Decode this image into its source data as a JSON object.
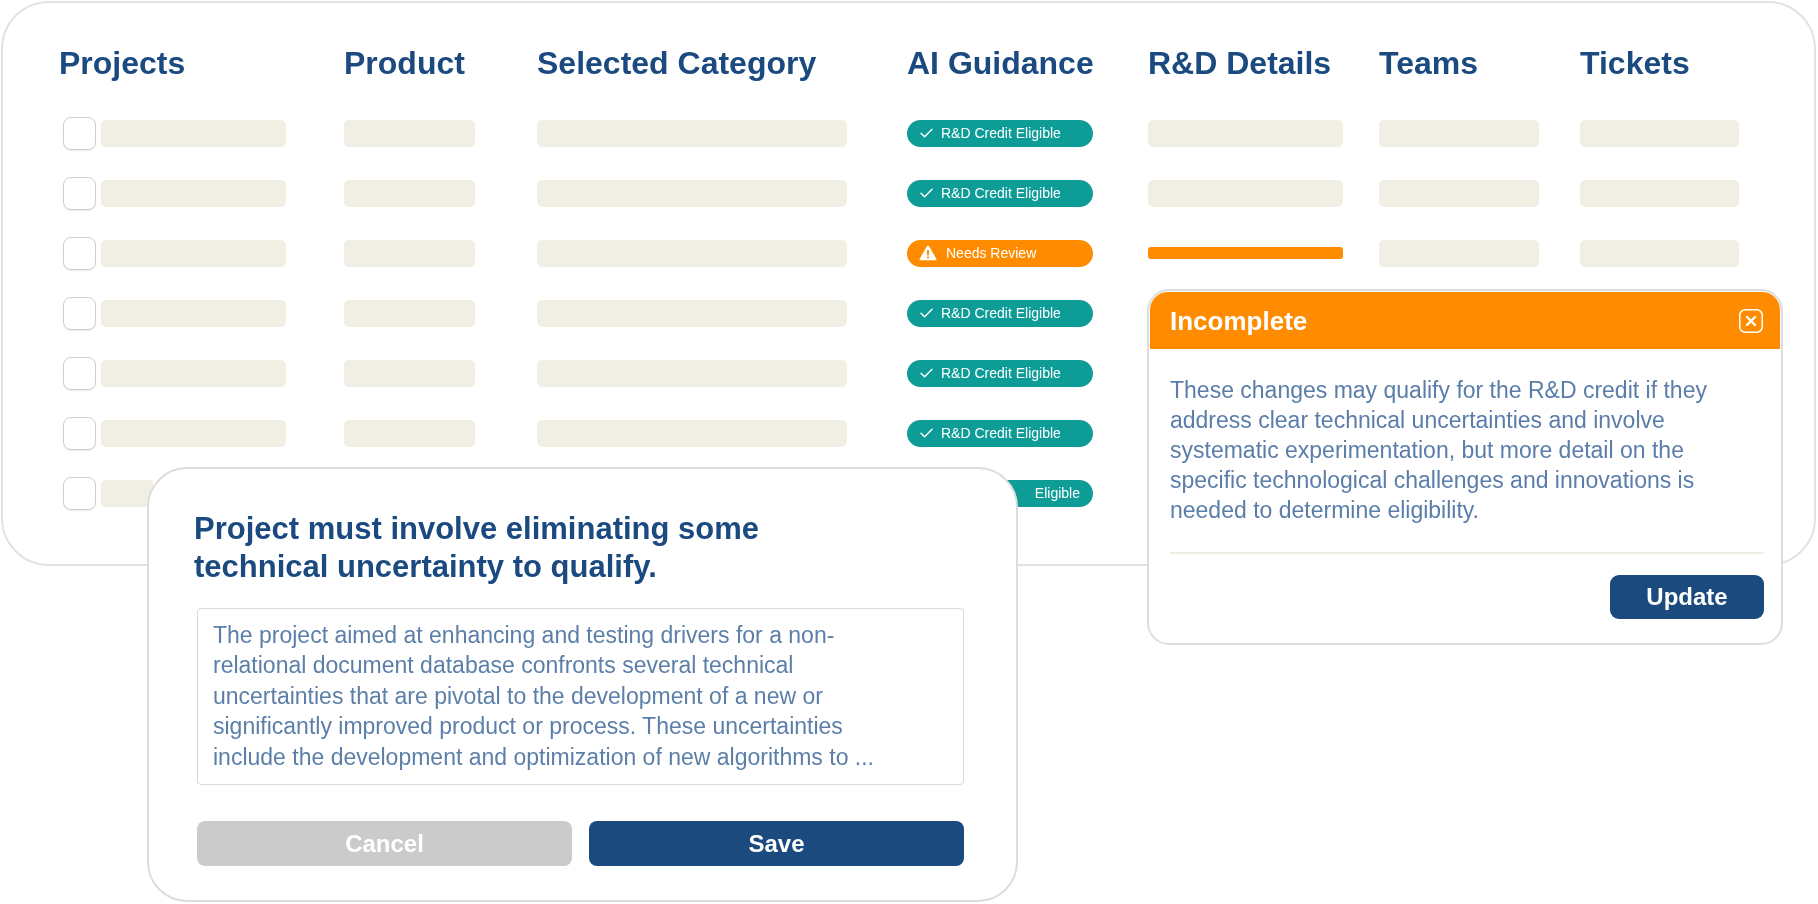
{
  "table": {
    "columns": [
      "Projects",
      "Product",
      "Selected Category",
      "AI Guidance",
      "R&D Details",
      "Teams",
      "Tickets"
    ],
    "rows": [
      {
        "checked": false,
        "project": {
          "kind": "skeleton",
          "clipped": false
        },
        "product": {
          "kind": "skeleton"
        },
        "category": {
          "kind": "skeleton"
        },
        "guidance": {
          "kind": "eligible",
          "label": "R&D Credit Eligible",
          "clipped": false
        },
        "details": {
          "kind": "skeleton"
        },
        "teams": {
          "kind": "skeleton"
        },
        "tickets": {
          "kind": "skeleton"
        }
      },
      {
        "checked": false,
        "project": {
          "kind": "skeleton",
          "clipped": false
        },
        "product": {
          "kind": "skeleton"
        },
        "category": {
          "kind": "skeleton"
        },
        "guidance": {
          "kind": "eligible",
          "label": "R&D Credit Eligible",
          "clipped": false
        },
        "details": {
          "kind": "skeleton"
        },
        "teams": {
          "kind": "skeleton"
        },
        "tickets": {
          "kind": "skeleton"
        }
      },
      {
        "checked": false,
        "project": {
          "kind": "skeleton",
          "clipped": false
        },
        "product": {
          "kind": "skeleton"
        },
        "category": {
          "kind": "skeleton"
        },
        "guidance": {
          "kind": "review",
          "label": "Needs Review",
          "clipped": false
        },
        "details": {
          "kind": "flagged"
        },
        "teams": {
          "kind": "skeleton"
        },
        "tickets": {
          "kind": "skeleton"
        }
      },
      {
        "checked": false,
        "project": {
          "kind": "skeleton",
          "clipped": false
        },
        "product": {
          "kind": "skeleton"
        },
        "category": {
          "kind": "skeleton"
        },
        "guidance": {
          "kind": "eligible",
          "label": "R&D Credit Eligible",
          "clipped": false
        }
      },
      {
        "checked": false,
        "project": {
          "kind": "skeleton",
          "clipped": false
        },
        "product": {
          "kind": "skeleton"
        },
        "category": {
          "kind": "skeleton"
        },
        "guidance": {
          "kind": "eligible",
          "label": "R&D Credit Eligible",
          "clipped": false
        }
      },
      {
        "checked": false,
        "project": {
          "kind": "skeleton",
          "clipped": false
        },
        "product": {
          "kind": "skeleton"
        },
        "category": {
          "kind": "skeleton"
        },
        "guidance": {
          "kind": "eligible",
          "label": "R&D Credit Eligible",
          "clipped": false
        }
      },
      {
        "checked": false,
        "project": {
          "kind": "skeleton",
          "clipped": true
        },
        "guidance": {
          "kind": "eligible",
          "label": "Eligible",
          "clipped": true
        }
      }
    ]
  },
  "incomplete_popup": {
    "title": "Incomplete",
    "message": "These changes may qualify for the R&D credit if they address clear technical uncertainties and involve systematic experimentation, but more detail on the specific technological challenges and innovations is needed to determine eligibility.",
    "button": "Update"
  },
  "requirement_dialog": {
    "title": "Project must involve eliminating some technical uncertainty to qualify.",
    "description": "The project aimed at enhancing and testing drivers for a non-relational document database confronts several technical uncertainties that are pivotal to the development of a new or significantly improved product or process. These uncertainties include the development and optimization of new algorithms to ...",
    "buttons": [
      {
        "kind": "secondary",
        "label": "Cancel"
      },
      {
        "kind": "primary",
        "label": "Save"
      }
    ]
  }
}
